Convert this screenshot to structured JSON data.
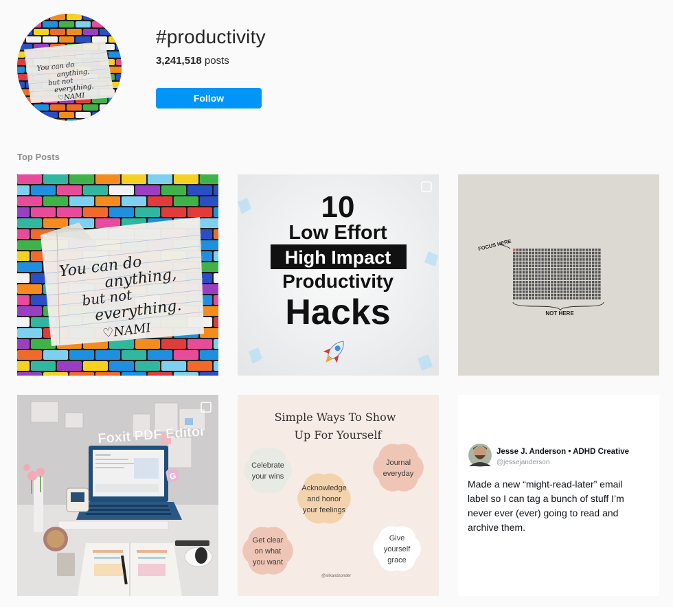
{
  "header": {
    "hashtag": "#productivity",
    "post_count": "3,241,518",
    "posts_label": "posts",
    "follow_label": "Follow",
    "avatar_note": [
      "You can do",
      "anything,",
      "but not",
      "everything.",
      "♡NAMI"
    ]
  },
  "section": {
    "title": "Top Posts"
  },
  "posts": [
    {
      "note_lines": [
        "You can do",
        "anything,",
        "but not",
        "everything.",
        "♡NAMI"
      ]
    },
    {
      "lines": [
        "10",
        "Low Effort",
        "High Impact",
        "Productivity",
        "Hacks"
      ]
    },
    {
      "focus_label": "FOCUS HERE",
      "not_label": "NOT HERE"
    },
    {
      "sticker_text": "Foxit PDF Editor"
    },
    {
      "title_lines": [
        "Simple Ways To Show",
        "Up For Yourself"
      ],
      "flowers": [
        [
          "Celebrate",
          "your wins"
        ],
        [
          "Journal",
          "everyday"
        ],
        [
          "Acknowledge",
          "and honor",
          "your feelings"
        ],
        [
          "Get clear",
          "on what",
          "you want"
        ],
        [
          "Give",
          "yourself",
          "grace"
        ]
      ],
      "handle": "@silkandsonder"
    },
    {
      "author_name": "Jesse J. Anderson • ADHD Creative",
      "author_handle": "@jessejanderson",
      "tweet_lines": [
        "Made a new “might-read-later” email",
        "label so I can tag a bunch of stuff I’m",
        "never ever (ever) going to read and",
        "archive them."
      ]
    }
  ],
  "colors": {
    "accent": "#0095f6",
    "muted": "#8e8e8e"
  }
}
